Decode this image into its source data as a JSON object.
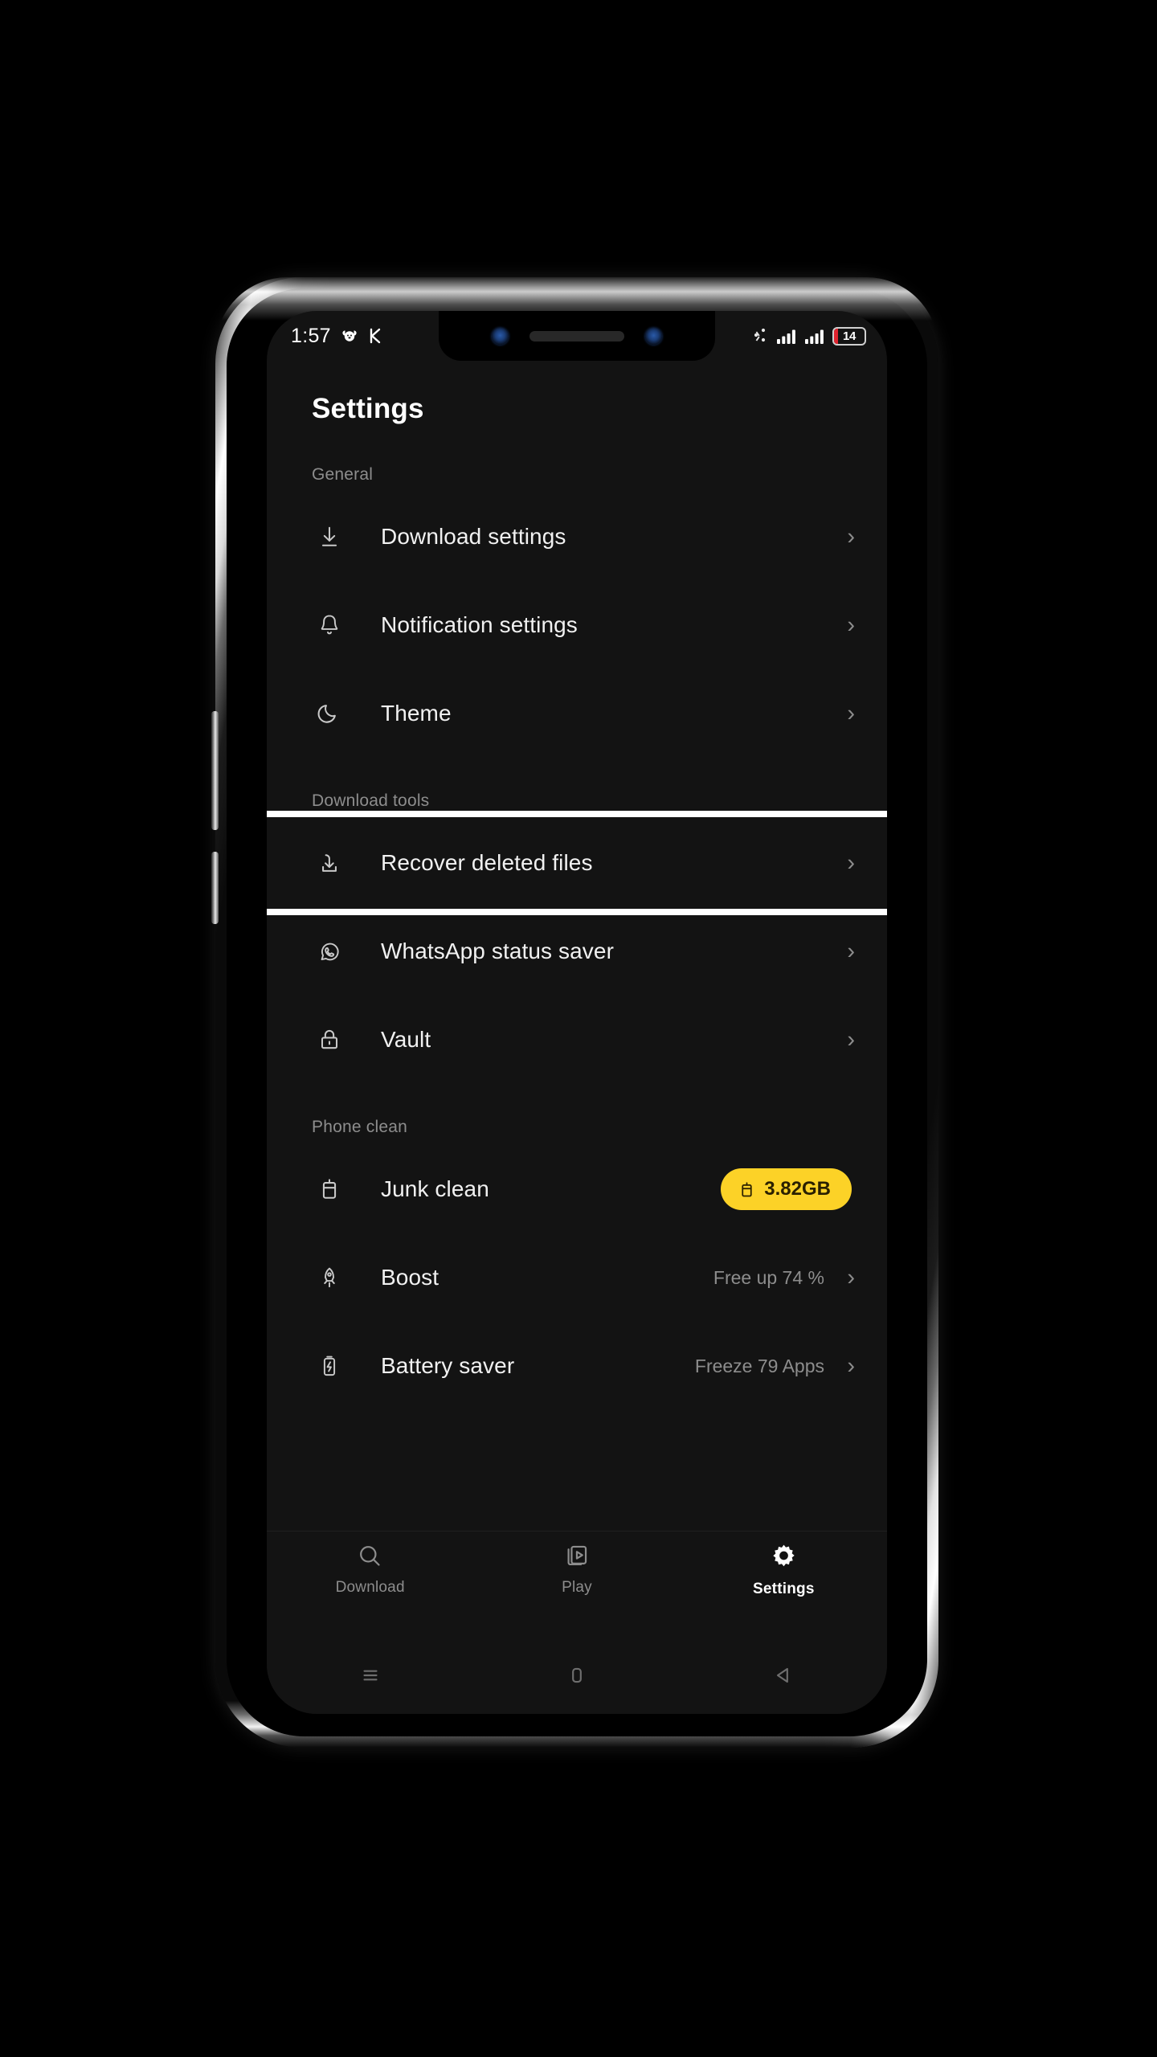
{
  "status_bar": {
    "time": "1:57",
    "left_icons": [
      "dog-headphones-icon",
      "k-app-icon"
    ],
    "right_icons": [
      "data-share-icon",
      "signal-bars-icon",
      "signal-bars-icon"
    ],
    "battery_level": "14"
  },
  "header": {
    "title": "Settings"
  },
  "sections": [
    {
      "title": "General",
      "items": [
        {
          "label": "Download settings",
          "icon": "download-icon",
          "value": "",
          "chevron": "›"
        },
        {
          "label": "Notification settings",
          "icon": "bell-icon",
          "value": "",
          "chevron": "›"
        },
        {
          "label": "Theme",
          "icon": "moon-icon",
          "value": "",
          "chevron": "›"
        }
      ]
    },
    {
      "title": "Download tools",
      "items": [
        {
          "label": "Recover deleted files",
          "icon": "recover-download-icon",
          "value": "",
          "chevron": "›",
          "highlighted": true
        },
        {
          "label": "WhatsApp status saver",
          "icon": "whatsapp-icon",
          "value": "",
          "chevron": "›"
        },
        {
          "label": "Vault",
          "icon": "lock-icon",
          "value": "",
          "chevron": "›"
        }
      ]
    },
    {
      "title": "Phone clean",
      "items": [
        {
          "label": "Junk clean",
          "icon": "trash-bin-icon",
          "badge": "3.82GB",
          "badge_icon": "trash-bin-icon"
        },
        {
          "label": "Boost",
          "icon": "rocket-icon",
          "value": "Free up 74 %",
          "chevron": "›"
        },
        {
          "label": "Battery saver",
          "icon": "battery-bolt-icon",
          "value": "Freeze 79 Apps",
          "chevron": "›"
        }
      ]
    }
  ],
  "tabbar": {
    "items": [
      {
        "label": "Download",
        "icon": "search-icon",
        "active": false
      },
      {
        "label": "Play",
        "icon": "video-stack-icon",
        "active": false
      },
      {
        "label": "Settings",
        "icon": "gear-icon",
        "active": true
      }
    ]
  },
  "navbar": {
    "items": [
      {
        "name": "recents-button",
        "icon": "hamburger-icon"
      },
      {
        "name": "home-button",
        "icon": "rounded-square-icon"
      },
      {
        "name": "back-button",
        "icon": "back-triangle-icon"
      }
    ]
  },
  "colors": {
    "accent_yellow": "#fcd227",
    "screen_bg": "#131313",
    "highlight_border": "#ffffff",
    "battery_red": "#e0232e"
  }
}
